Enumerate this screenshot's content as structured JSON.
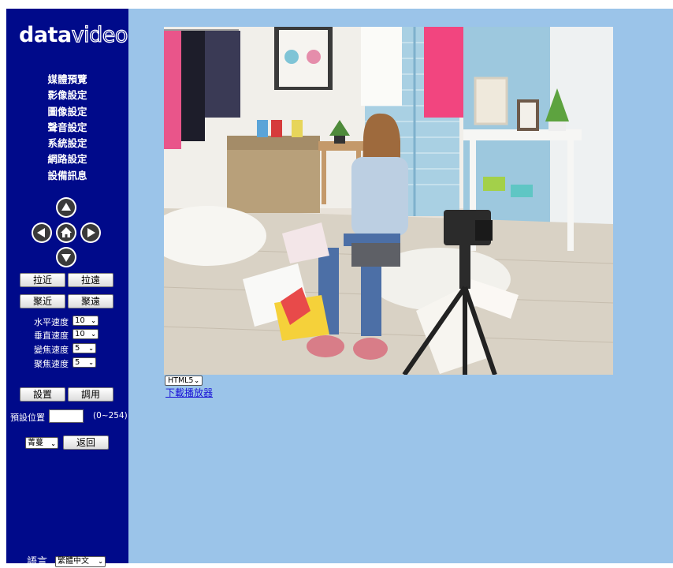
{
  "logo": {
    "bold": "data",
    "outline": "video"
  },
  "menu": [
    "媒體預覽",
    "影像設定",
    "圖像設定",
    "聲音設定",
    "系統設定",
    "網路設定",
    "設備訊息"
  ],
  "buttons": {
    "zoom_in": "拉近",
    "zoom_out": "拉遠",
    "focus_near": "聚近",
    "focus_far": "聚遠",
    "set": "設置",
    "call": "調用",
    "back": "返回"
  },
  "speeds": [
    {
      "label": "水平速度",
      "value": "10"
    },
    {
      "label": "垂直速度",
      "value": "10"
    },
    {
      "label": "變焦速度",
      "value": "5"
    },
    {
      "label": "聚焦速度",
      "value": "5"
    }
  ],
  "preset": {
    "label": "預設位置",
    "range": "(0~254)",
    "value": ""
  },
  "mode_select": "菁蔓",
  "language": {
    "label": "語言",
    "value": "繁體中文"
  },
  "player": {
    "selected": "HTML5",
    "download_link": "下載播放器"
  },
  "colors": {
    "sidebar": "#000a8a",
    "main": "#9bc4e9",
    "link": "#1a13d6"
  }
}
